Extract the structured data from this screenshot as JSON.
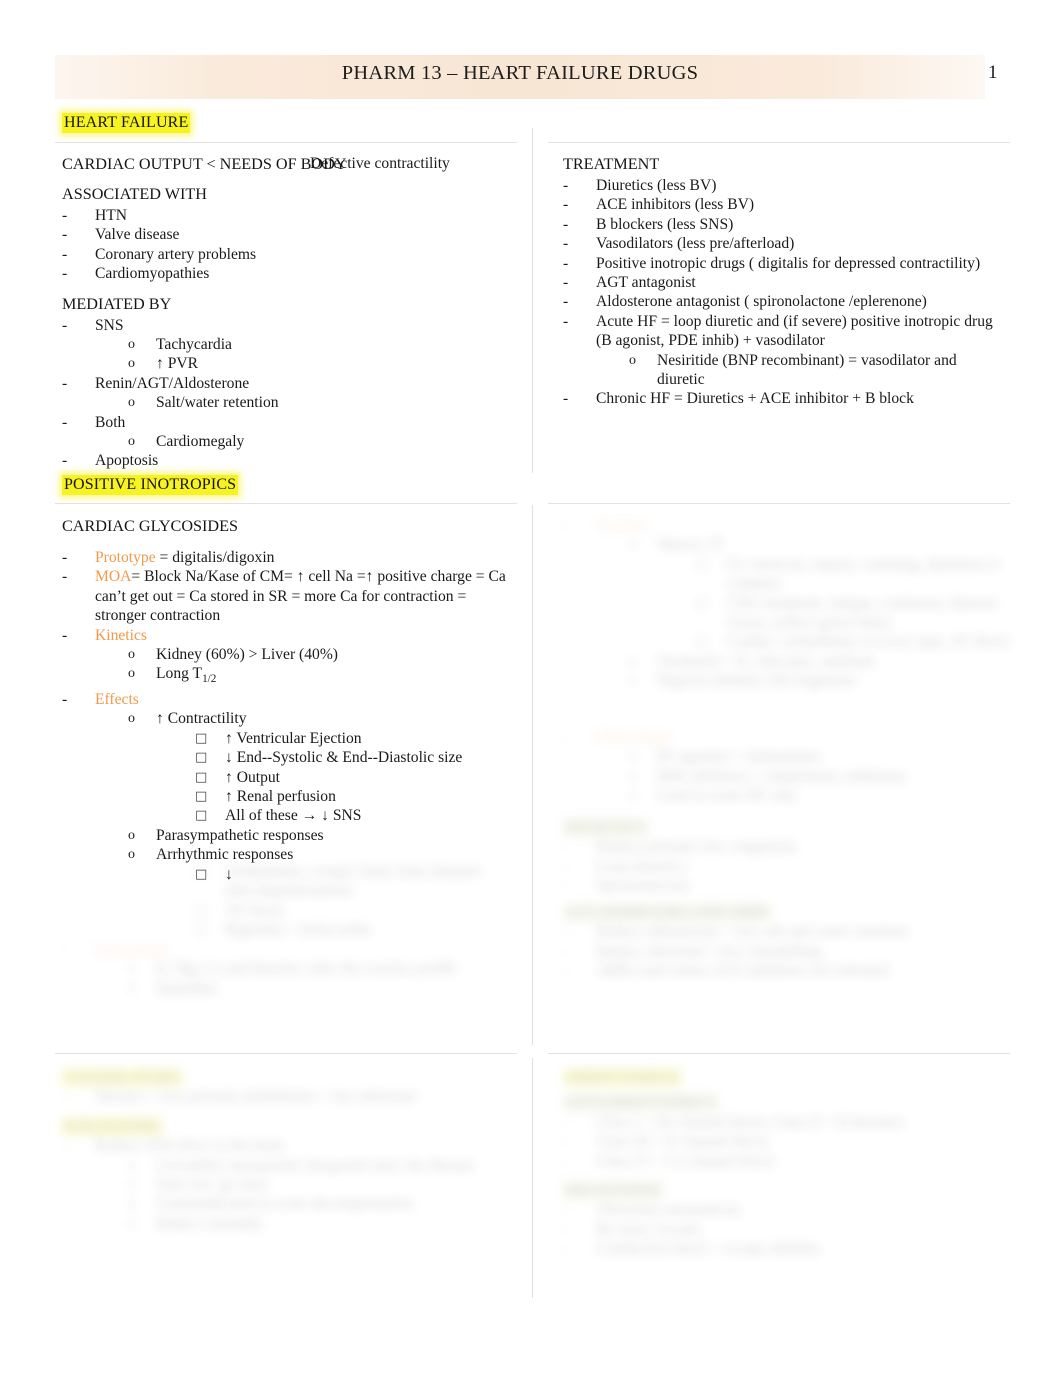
{
  "document": {
    "title": "PHARM 13 – HEART FAILURE DRUGS",
    "page_number": "1"
  },
  "sections": {
    "heart_failure": {
      "heading": "HEART FAILURE"
    },
    "positive_inotropics": {
      "heading": "POSITIVE INOTROPICS"
    }
  },
  "left_column": {
    "definition_line": "CARDIAC OUTPUT < NEEDS OF BODY",
    "definition_overlap": "Defective contractility",
    "associated_with": {
      "heading": "ASSOCIATED WITH",
      "items": [
        "HTN",
        "Valve disease",
        "Coronary artery problems",
        "Cardiomyopathies"
      ]
    },
    "mediated_by": {
      "heading": "MEDIATED BY",
      "items": [
        {
          "label": "SNS",
          "sub": [
            "Tachycardia",
            "↑ PVR"
          ]
        },
        {
          "label": "Renin/AGT/Aldosterone",
          "sub": [
            "Salt/water retention"
          ]
        },
        {
          "label": "Both",
          "sub": [
            "Cardiomegaly"
          ]
        },
        {
          "label": "Apoptosis",
          "sub": []
        }
      ]
    },
    "cardiac_glycosides": {
      "heading": "CARDIAC GLYCOSIDES",
      "prototype_label": "Prototype",
      "prototype_value": " = digitalis/digoxin",
      "moa_label": "MOA",
      "moa_value": "= Block Na/Kase of CM= ↑  cell Na =↑ positive charge = Ca can’t get out = Ca stored in SR = more Ca for contraction = stronger contraction",
      "kinetics_label": "Kinetics",
      "kinetics_items_1": "Kidney (60%) > Liver (40%)",
      "kinetics_items_2_pre": "Long T",
      "kinetics_items_2_sub": "1/2",
      "effects_label": "Effects",
      "effects": [
        {
          "label": "↑ Contractility",
          "sub": [
            "↑  Ventricular Ejection",
            "↓  End--Systolic &  End--Diastolic size",
            "↑  Output",
            "↑  Renal perfusion",
            "All of these → ↓  SNS"
          ]
        },
        {
          "label": "Parasympathetic responses",
          "sub": []
        },
        {
          "label": "Arrhythmic responses",
          "sub": [
            "↓"
          ]
        }
      ]
    }
  },
  "right_column": {
    "treatment": {
      "heading": "TREATMENT",
      "items": [
        "Diuretics (less BV)",
        "ACE inhibitors (less BV)",
        "B blockers (less SNS)",
        "Vasodilators (less pre/afterload)",
        "Positive inotropic drugs ( digitalis for depressed contractility)",
        "AGT antagonist",
        "Aldosterone antagonist (  spironolactone  /eplerenone)"
      ],
      "acute_hf_line1": "Acute HF = loop diuretic and (if severe) positive inotropic drug",
      "acute_hf_line2": "(B agonist, PDE inhib) + vasodilator",
      "acute_hf_sub1": "Nesiritide (BNP recombinant) = vasodilator and",
      "acute_hf_sub2": "diuretic",
      "chronic_hf": "Chronic HF = Diuretics + ACE inhibitor + B block"
    }
  },
  "obscured_regions": {
    "note": "blurred / illegible body text",
    "left_lower": [
      "o",
      "o",
      "o",
      "o",
      "o",
      "o"
    ],
    "right_lower": [
      "o",
      "o",
      "o",
      "o",
      "o",
      "o",
      "o"
    ]
  },
  "colors": {
    "header_band": "#f8e6d4",
    "highlight_yellow": "#f7f322",
    "keyword_orange": "#f2994a",
    "rule_grey": "#e2e2e2",
    "text": "#1a1a1a"
  }
}
